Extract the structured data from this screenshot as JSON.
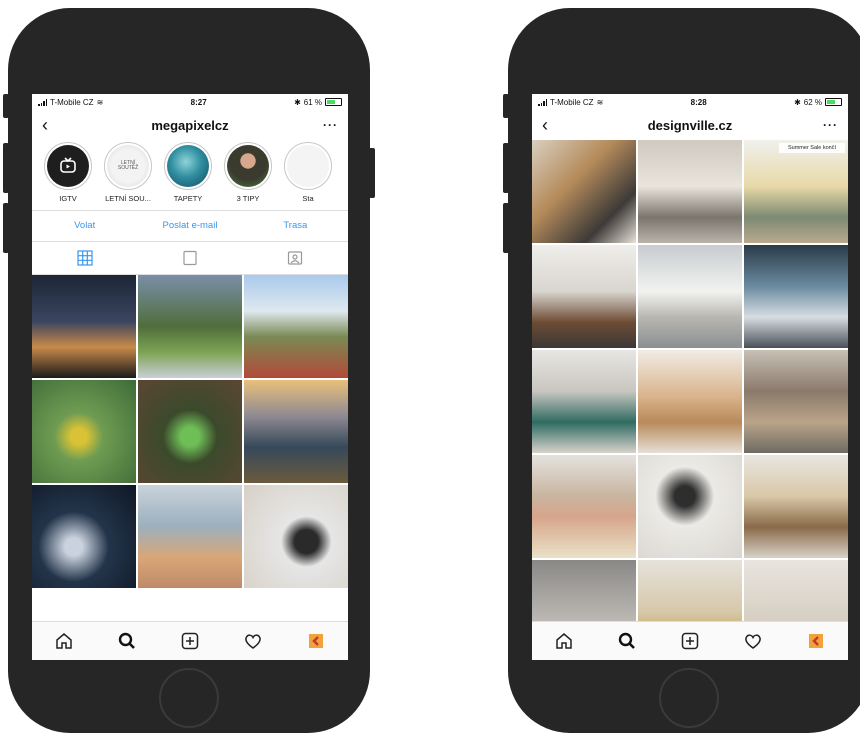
{
  "phone_left": {
    "status": {
      "carrier": "T-Mobile CZ",
      "time": "8:27",
      "battery": "61 %"
    },
    "username": "megapixelcz",
    "back_glyph": "‹",
    "more_glyph": "···",
    "highlights": [
      {
        "label": "IGTV"
      },
      {
        "label": "LETNÍ SOU..."
      },
      {
        "label": "TAPETY"
      },
      {
        "label": "3 TIPY"
      },
      {
        "label": "Sta"
      }
    ],
    "highlight_badge": "LETNÍ SOUTĚŽ",
    "actions": [
      "Volat",
      "Poslat e-mail",
      "Trasa"
    ],
    "tabs": [
      "grid-icon",
      "feed-icon",
      "tagged-icon"
    ],
    "grid_colors": [
      "linear-gradient(180deg,#1c2636 0%,#3a4560 45%,#c88a4a 70%,#1a1a1a 100%)",
      "linear-gradient(180deg,#7a8ea8 0%,#4f6e3c 50%,#7ea354 75%,#c9cfd6 100%)",
      "linear-gradient(180deg,#a9c9ec 0%,#dfe8ef 35%,#7a8a55 60%,#b24a38 100%)",
      "radial-gradient(circle at 45% 55%,#d9c235 0 10%,#6f9c52 30%,#3d6b38 100%)",
      "radial-gradient(circle at 50% 55%,#6fbf57 0 12%,#3b4a2c 35%,#5c4633 100%)",
      "linear-gradient(180deg,#e9c07a 0%,#8f8a92 35%,#36495a 65%,#6b5a3e 100%)",
      "radial-gradient(circle at 40% 60%,#c9d2de 0 10%,#23344a 40%,#0e1725 100%)",
      "linear-gradient(180deg,#c9d3da 0%,#9bb0be 40%,#d8a778 70%,#c08a6a 100%)",
      "radial-gradient(circle at 60% 55%,#2a2a2a 0 14%,#e6e6e6 30%,#d7d0c6 100%)"
    ]
  },
  "phone_right": {
    "status": {
      "carrier": "T-Mobile CZ",
      "time": "8:28",
      "battery": "62 %"
    },
    "username": "designville.cz",
    "back_glyph": "‹",
    "more_glyph": "···",
    "banner": "Summer Sale končí",
    "grid_colors": [
      "linear-gradient(135deg,#d9cfc0 0%,#b48a5a 40%,#3d3a38 75%,#e8e2d8 100%)",
      "linear-gradient(180deg,#cfc9c0 0%,#e9e4dc 45%,#7a756d 75%,#b9b3aa 100%)",
      "linear-gradient(180deg,#f0f0ee 0%,#e8d9a7 45%,#7d8a72 75%,#b9a98e 100%)",
      "linear-gradient(180deg,#efeeea 0%,#d9d5cf 45%,#6d4c35 75%,#3a3836 100%)",
      "linear-gradient(180deg,#c8ccd0 0%,#f2f2f0 45%,#b9b7b0 70%,#8a8f93 100%)",
      "linear-gradient(180deg,#2b3b48 0%,#6a8aa0 40%,#d7dde2 70%,#4a5058 100%)",
      "linear-gradient(180deg,#e8e6e2 0%,#c9c6c0 40%,#2f6b62 70%,#d6d2cb 100%)",
      "linear-gradient(180deg,#f1ece5 0%,#d9b48c 45%,#b98a5a 70%,#e6dfd6 100%)",
      "linear-gradient(180deg,#c8c0b6 0%,#8a7a6a 40%,#b9a48a 70%,#6f6a62 100%)",
      "linear-gradient(180deg,#e4e2de 0%,#c9b5a0 40%,#d7a58b 60%,#e9e2c8 100%)",
      "radial-gradient(circle at 45% 40%,#2e2e2e 0 12%,#eceae6 35%,#d9d6d0 100%)",
      "linear-gradient(180deg,#e9e6e0 0%,#d9c8a8 40%,#8a6a48 70%,#d8d2c8 100%)",
      "linear-gradient(180deg,#8a8886 0%,#bdbab5 60%,#cfcbc4 100%)",
      "linear-gradient(180deg,#e6e2dc 0%,#d6c8aa 50%,#c7a24a 80%,#ddd7cd 100%)",
      "linear-gradient(180deg,#e8e5df 0%,#d9d2c6 50%,#c9bfae 100%)"
    ]
  },
  "bottom_nav": [
    "home-icon",
    "search-icon",
    "add-post-icon",
    "heart-icon",
    "profile-avatar"
  ],
  "colors": {
    "link_blue": "#3897f0",
    "phone_body": "#262626",
    "battery_green": "#4cd964"
  }
}
